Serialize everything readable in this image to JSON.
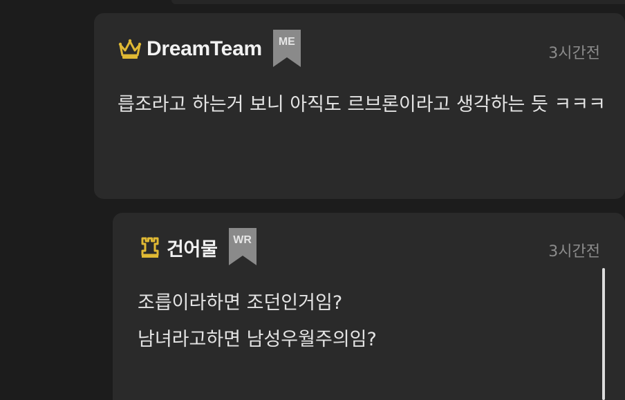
{
  "comments": [
    {
      "username": "DreamTeam",
      "badge_icon": "crown-icon",
      "tag": "ME",
      "time": "3시간전",
      "text": "릅조라고 하는거 보니 아직도 르브론이라고 생각하는 듯 ㅋㅋㅋ"
    }
  ],
  "reply": {
    "username": "건어물",
    "badge_icon": "rook-icon",
    "tag": "WR",
    "time": "3시간전",
    "lines": [
      "조릅이라하면 조던인거임?",
      "남녀라고하면 남성우월주의임?"
    ]
  },
  "colors": {
    "background": "#1c1c1c",
    "card": "#2a2a2a",
    "badge_gold": "#e0b934",
    "ribbon": "#8a8a8a",
    "muted_text": "#8c8c8c"
  }
}
